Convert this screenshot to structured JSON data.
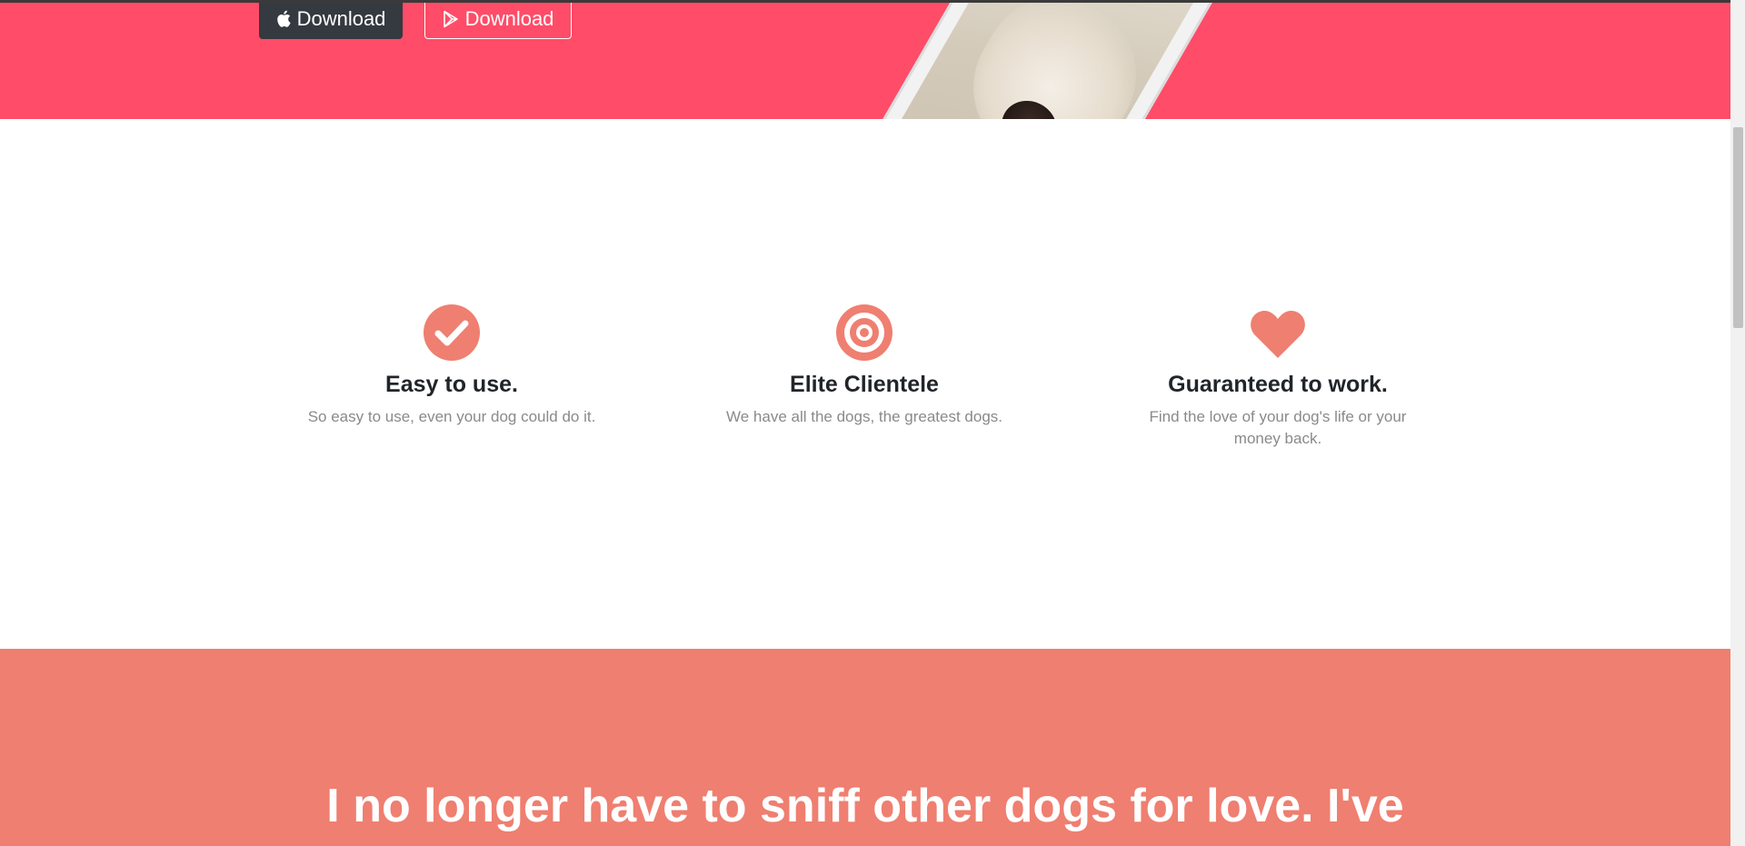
{
  "hero": {
    "apple_button": {
      "label": "Download",
      "icon": "apple-icon"
    },
    "play_button": {
      "label": "Download",
      "icon": "google-play-icon"
    },
    "image": "phone-with-dog-photo",
    "background": "#ff4c68"
  },
  "features": [
    {
      "icon": "check-circle-icon",
      "title": "Easy to use.",
      "text": "So easy to use, even your dog could do it."
    },
    {
      "icon": "bullseye-icon",
      "title": "Elite Clientele",
      "text": "We have all the dogs, the greatest dogs."
    },
    {
      "icon": "heart-icon",
      "title": "Guaranteed to work.",
      "text": "Find the love of your dog's life or your money back."
    }
  ],
  "testimonial": {
    "quote": "I no longer have to sniff other dogs for love. I've",
    "background": "#ef7f70"
  },
  "colors": {
    "accent": "#ef7f70",
    "hero_pink": "#ff4c68",
    "dark_button": "#343a40"
  }
}
